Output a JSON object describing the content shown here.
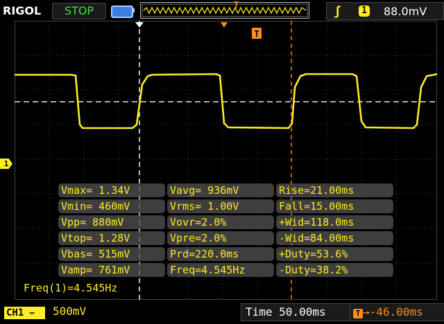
{
  "header": {
    "brand": "RIGOL",
    "run_state": "STOP",
    "trigger_channel": "1",
    "trigger_level": "88.0mV",
    "trigger_pos_label": "T"
  },
  "channel": {
    "marker": "1",
    "badge": "CH1",
    "scale": "500mV"
  },
  "measurements": {
    "rows": [
      [
        "Vmax= 1.34V",
        "Vavg= 936mV",
        "Rise=21.00ms"
      ],
      [
        "Vmin= 460mV",
        "Vrms= 1.00V",
        "Fall=15.00ms"
      ],
      [
        "Vpp= 880mV",
        "Vovr=2.0%",
        "+Wid=118.0ms"
      ],
      [
        "Vtop= 1.28V",
        "Vpre=2.0%",
        "-Wid=84.00ms"
      ],
      [
        "Vbas= 515mV",
        "Prd=220.0ms",
        "+Duty=53.6%"
      ],
      [
        "Vamp= 761mV",
        "Freq=4.545Hz",
        "-Duty=38.2%"
      ]
    ],
    "frequency_readout": "Freq(1)=4.545Hz"
  },
  "timebase": {
    "label": "Time",
    "value": "50.00ms",
    "display": "Time 50.00ms"
  },
  "trigger_offset": {
    "icon_label": "T",
    "value": "-46.00ms"
  },
  "colors": {
    "trace": "#ffee22",
    "trigger": "#ff8a1f",
    "run_state": "#3ee23e",
    "grid": "#5a5a5a"
  }
}
